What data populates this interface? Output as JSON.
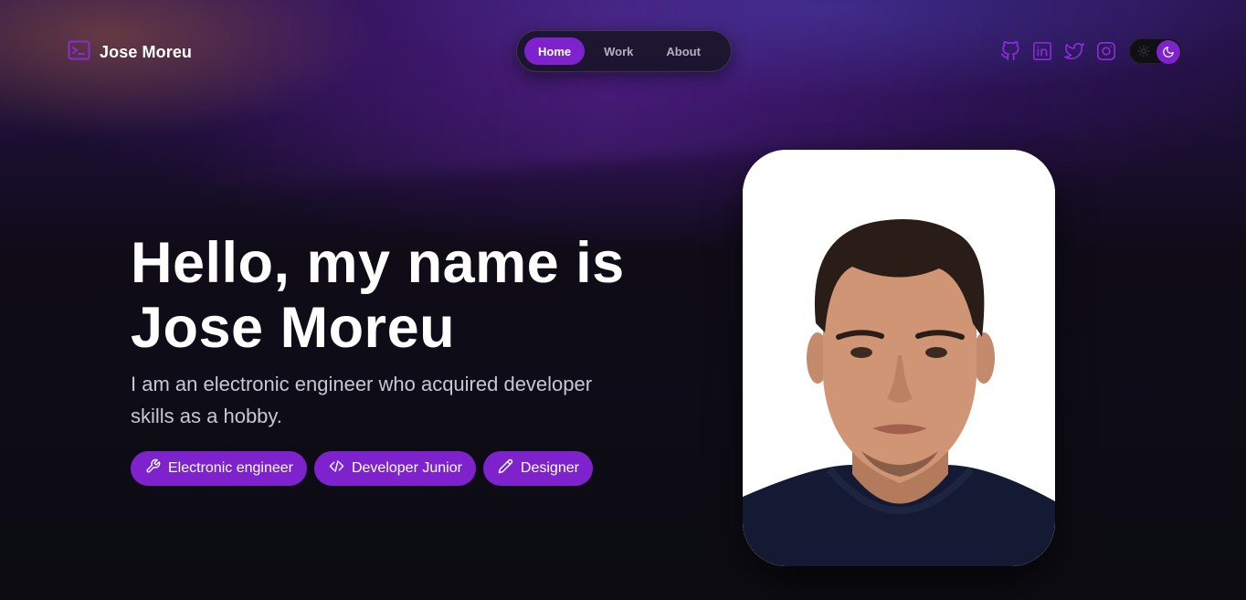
{
  "brand": {
    "name": "Jose Moreu",
    "icon": "terminal-icon"
  },
  "nav": {
    "items": [
      {
        "label": "Home",
        "active": true
      },
      {
        "label": "Work",
        "active": false
      },
      {
        "label": "About",
        "active": false
      }
    ]
  },
  "socials": [
    {
      "name": "github-icon"
    },
    {
      "name": "linkedin-icon"
    },
    {
      "name": "twitter-icon"
    },
    {
      "name": "instagram-icon"
    }
  ],
  "theme_toggle": {
    "mode": "dark",
    "icons": [
      "sun-icon",
      "moon-icon"
    ]
  },
  "hero": {
    "title_line1": "Hello, my name is",
    "title_line2": "Jose Moreu",
    "subtitle": "I am an electronic engineer who acquired developer skills as a hobby.",
    "pills": [
      {
        "label": "Electronic engineer",
        "icon": "wrench-icon"
      },
      {
        "label": "Developer Junior",
        "icon": "code-icon"
      },
      {
        "label": "Designer",
        "icon": "pencil-icon"
      }
    ]
  },
  "colors": {
    "accent": "#7e22ce",
    "background": "#0c0c12",
    "text": "#ffffff",
    "muted": "#c9c6d6"
  }
}
